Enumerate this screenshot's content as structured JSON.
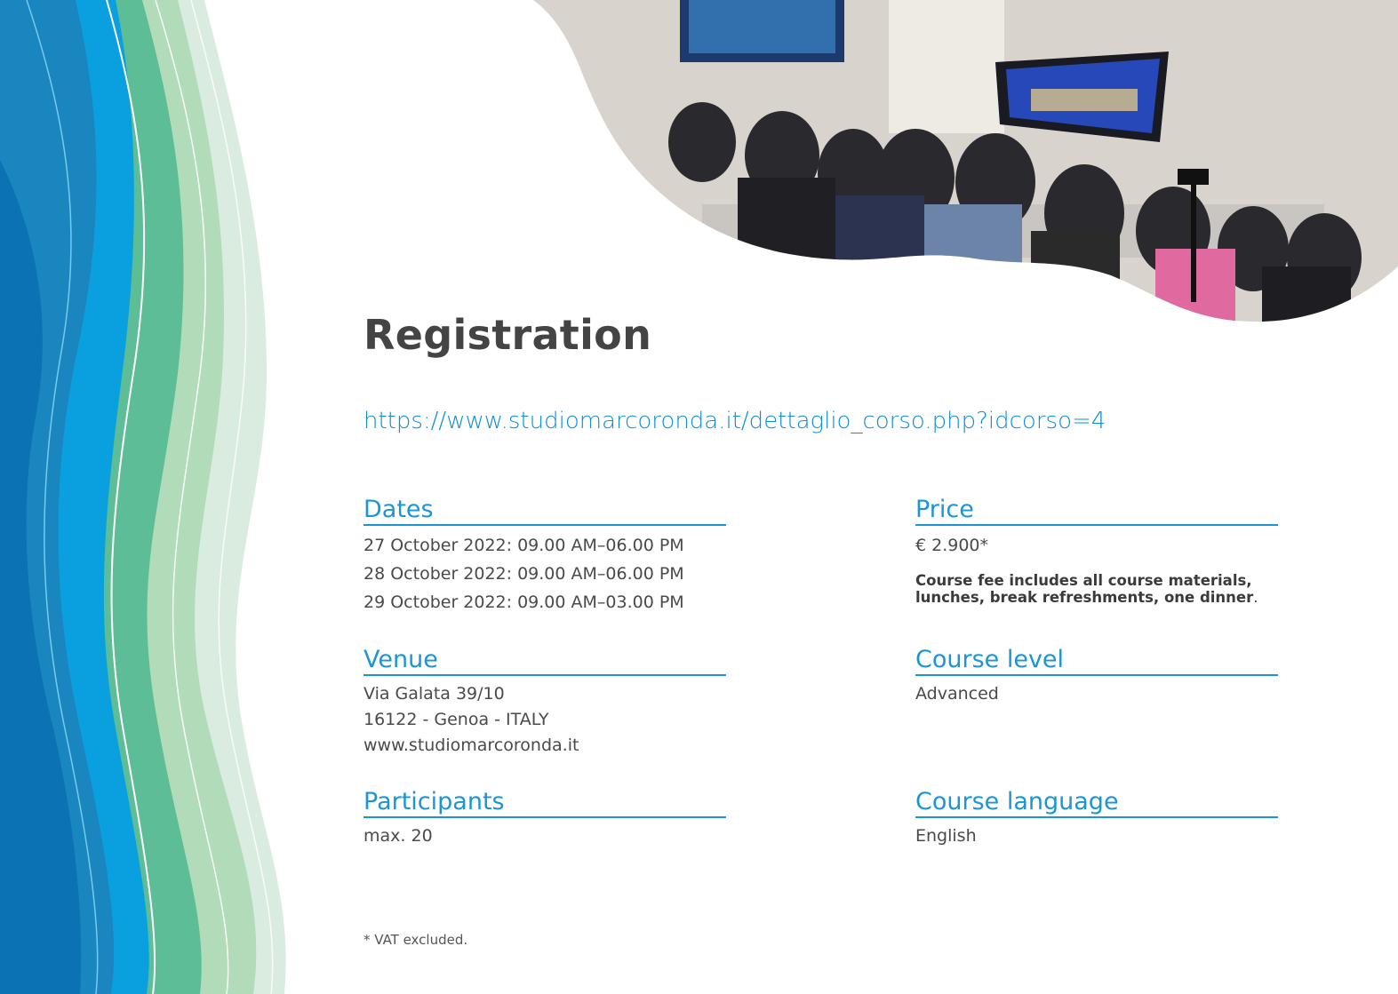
{
  "page": {
    "title": "Registration",
    "url": "https://www.studiomarcoronda.it/dettaglio_corso.php?idcorso=4",
    "footnote": "* VAT excluded."
  },
  "sections": {
    "dates": {
      "heading": "Dates",
      "lines": [
        "27 October 2022: 09.00 AM–06.00 PM",
        "28 October 2022: 09.00 AM–06.00 PM",
        "29 October 2022: 09.00 AM–03.00 PM"
      ]
    },
    "price": {
      "heading": "Price",
      "value": "€ 2.900*",
      "note": "Course fee includes all course materials, lunches, break refreshments, one dinner",
      "note_end": "."
    },
    "venue": {
      "heading": "Venue",
      "lines": [
        "Via Galata 39/10",
        "16122 - Genoa - ITALY",
        "www.studiomarcoronda.it"
      ]
    },
    "course_level": {
      "heading": "Course level",
      "value": "Advanced"
    },
    "participants": {
      "heading": "Participants",
      "value": "max. 20"
    },
    "course_language": {
      "heading": "Course language",
      "value": "English"
    }
  },
  "colors": {
    "accent": "#1a96d6",
    "wave_dark_blue": "#0a6fb0",
    "wave_bright_blue": "#0aa0e0",
    "wave_teal": "#3fb58f",
    "wave_light_green": "#a8d8b4"
  }
}
